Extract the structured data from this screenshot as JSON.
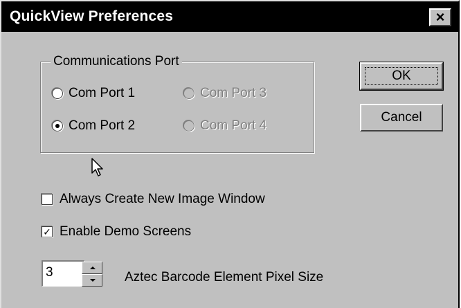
{
  "window": {
    "title": "QuickView Preferences",
    "close_glyph": "×"
  },
  "comm_port": {
    "legend": "Communications Port",
    "options": [
      {
        "label": "Com Port 1",
        "selected": false,
        "enabled": true
      },
      {
        "label": "Com Port 2",
        "selected": true,
        "enabled": true
      },
      {
        "label": "Com Port 3",
        "selected": false,
        "enabled": false
      },
      {
        "label": "Com Port 4",
        "selected": false,
        "enabled": false
      }
    ]
  },
  "buttons": {
    "ok_label": "OK",
    "cancel_label": "Cancel"
  },
  "options": {
    "new_image_window_label": "Always Create New Image Window",
    "new_image_window_checked": false,
    "demo_screens_label": "Enable Demo Screens",
    "demo_screens_checked": true
  },
  "pixel_size": {
    "value": "3",
    "label": "Aztec Barcode Element Pixel Size"
  },
  "icons": {
    "close": "close-icon",
    "pointer": "mouse-pointer-icon",
    "check": "checkmark-icon"
  }
}
